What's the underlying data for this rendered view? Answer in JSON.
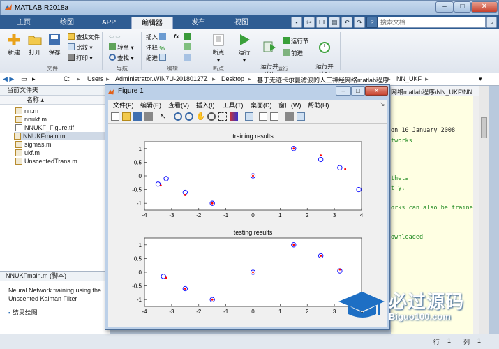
{
  "app": {
    "title": "MATLAB R2018a",
    "accent": "#2f5d93"
  },
  "tabs": [
    {
      "label": "主页"
    },
    {
      "label": "绘图"
    },
    {
      "label": "APP"
    },
    {
      "label": "编辑器",
      "active": true
    },
    {
      "label": "发布"
    },
    {
      "label": "视图"
    }
  ],
  "search": {
    "placeholder": "搜索文档"
  },
  "ribbon": {
    "file": {
      "new": "新建",
      "open": "打开",
      "save": "保存",
      "find_files": "查找文件",
      "compare": "比较",
      "print": "打印",
      "group": "文件"
    },
    "navigate": {
      "goto": "转至",
      "find": "查找",
      "group": "导航"
    },
    "edit": {
      "insert": "插入",
      "comment": "注释",
      "indent": "缩进",
      "fx": "fx",
      "group": "编辑"
    },
    "breakpoints": {
      "label": "断点",
      "group": "断点"
    },
    "run": {
      "run": "运行",
      "run_advance": "运行并\n前进",
      "run_section": "运行节",
      "advance": "前进",
      "run_time": "运行并\n计时",
      "group": "运行"
    }
  },
  "address": {
    "drive": "C:",
    "parts": [
      "Users",
      "Administrator.WIN7U-20180127Z",
      "Desktop",
      "基于无迹卡尔曼滤波的人工神经网络matlab程序",
      "NN_UKF"
    ]
  },
  "current_folder": {
    "title": "当前文件夹",
    "column": "名称",
    "files": [
      {
        "name": "nn.m",
        "type": "m"
      },
      {
        "name": "nnukf.m",
        "type": "m"
      },
      {
        "name": "NNUKF_Figure.tif",
        "type": "tif"
      },
      {
        "name": "NNUKFmain.m",
        "type": "m",
        "selected": true
      },
      {
        "name": "sigmas.m",
        "type": "m"
      },
      {
        "name": "ukf.m",
        "type": "m"
      },
      {
        "name": "UnscentedTrans.m",
        "type": "m"
      }
    ]
  },
  "details": {
    "title": "NNUKFmain.m  (脚本)",
    "desc1": "Neural Network training using the",
    "desc2": "Unscented Kalman Filter",
    "result": "结果绘图"
  },
  "editor": {
    "path_tail": "网络matlab程序\\NN_UKF\\NN",
    "lines": [
      {
        "text": "on 10 January 2008",
        "color": "#000000"
      },
      {
        "text": "tworks",
        "color": "#228b22"
      },
      {
        "text": "theta",
        "color": "#228b22"
      },
      {
        "text": "t y.",
        "color": "#228b22"
      },
      {
        "text": "orks can also be trained",
        "color": "#228b22"
      },
      {
        "text": "ownloaded",
        "color": "#228b22"
      }
    ]
  },
  "figure": {
    "title": "Figure 1",
    "menus": [
      "文件(F)",
      "编辑(E)",
      "查看(V)",
      "插入(I)",
      "工具(T)",
      "桌面(D)",
      "窗口(W)",
      "帮助(H)"
    ]
  },
  "status": {
    "row_label": "行",
    "row": "1",
    "col_label": "列",
    "col": "1"
  },
  "watermark": {
    "cn": "必过源码",
    "url": "Biguo100.com"
  },
  "chart_data": [
    {
      "type": "scatter",
      "title": "training results",
      "xlim": [
        -4,
        4
      ],
      "ylim": [
        -1.25,
        1.25
      ],
      "xticks": [
        -4,
        -3,
        -2,
        -1,
        0,
        1,
        2,
        3,
        4
      ],
      "yticks": [
        -1,
        -0.5,
        0,
        0.5,
        1
      ],
      "series": [
        {
          "marker": "circle",
          "color": "#0000ff",
          "x": [
            -3.5,
            -3.2,
            -2.5,
            -1.5,
            0.0,
            1.5,
            2.5,
            3.2,
            3.9
          ],
          "y": [
            -0.3,
            -0.1,
            -0.6,
            -1.0,
            0.0,
            1.0,
            0.6,
            0.3,
            -0.5
          ]
        },
        {
          "marker": "dot",
          "color": "#ff0000",
          "x": [
            -3.4,
            -2.5,
            -1.5,
            0.0,
            1.5,
            2.5,
            3.4
          ],
          "y": [
            -0.35,
            -0.7,
            -1.0,
            0.0,
            1.0,
            0.75,
            0.25
          ]
        }
      ]
    },
    {
      "type": "scatter",
      "title": "testing results",
      "xlim": [
        -4,
        4
      ],
      "ylim": [
        -1.25,
        1.25
      ],
      "xticks": [
        -4,
        -3,
        -2,
        -1,
        0,
        1,
        2,
        3,
        4
      ],
      "yticks": [
        -1,
        -0.5,
        0,
        0.5,
        1
      ],
      "series": [
        {
          "marker": "circle",
          "color": "#0000ff",
          "x": [
            -3.3,
            -2.5,
            -1.5,
            0.0,
            1.5,
            2.5,
            3.2
          ],
          "y": [
            -0.15,
            -0.6,
            -1.0,
            0.0,
            1.0,
            0.6,
            0.05
          ]
        },
        {
          "marker": "dot",
          "color": "#ff0000",
          "x": [
            -3.2,
            -2.5,
            -1.5,
            0.0,
            1.5,
            2.5,
            3.2
          ],
          "y": [
            -0.2,
            -0.6,
            -1.0,
            0.0,
            1.0,
            0.6,
            0.1
          ]
        }
      ]
    }
  ]
}
